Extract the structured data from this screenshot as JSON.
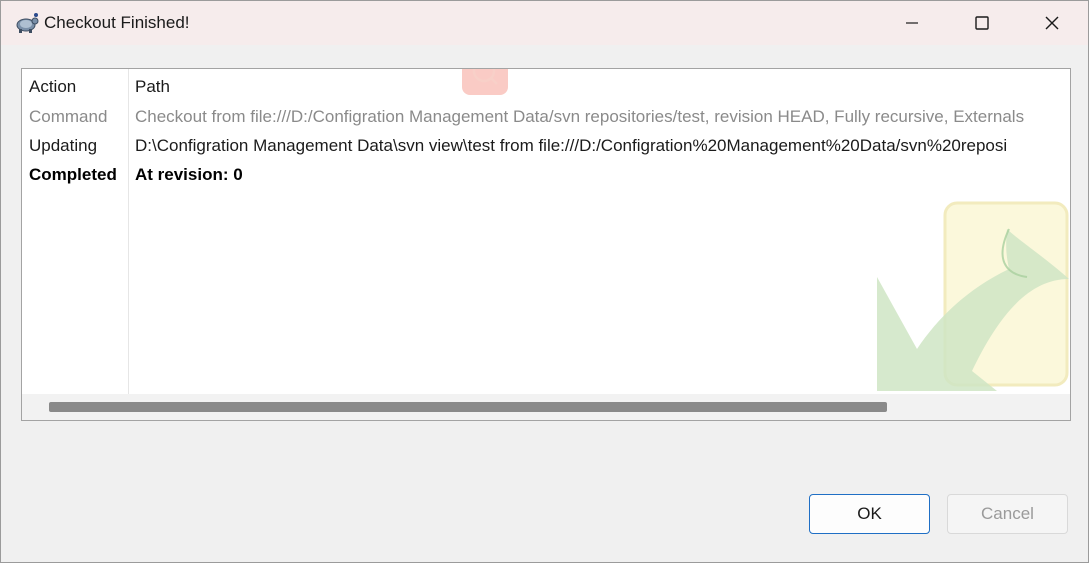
{
  "window": {
    "title": "Checkout Finished!",
    "icons": {
      "app": "tortoise-icon",
      "minimize": "minimize-icon",
      "maximize": "maximize-icon",
      "close": "close-icon"
    }
  },
  "list": {
    "columns": [
      "Action",
      "Path"
    ],
    "rows": [
      {
        "action": "Command",
        "path": "Checkout from file:///D:/Configration Management Data/svn repositories/test, revision HEAD, Fully recursive, Externals",
        "style": "gray"
      },
      {
        "action": "Updating",
        "path": "D:\\Configration Management Data\\svn view\\test from file:///D:/Configration%20Management%20Data/svn%20reposi",
        "style": "normal"
      },
      {
        "action": "Completed",
        "path": "At revision: 0",
        "style": "bold"
      }
    ]
  },
  "buttons": {
    "ok": "OK",
    "cancel": "Cancel"
  },
  "colors": {
    "accent": "#1f6fc5",
    "title_bar": "#f6ecec",
    "watermark_green": "#7fbf6a"
  }
}
